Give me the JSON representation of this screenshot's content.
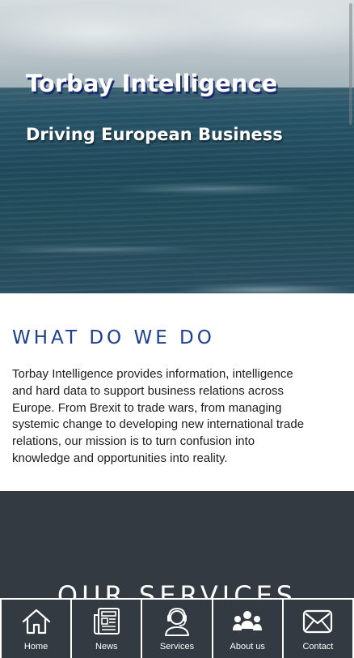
{
  "hero": {
    "title": "Torbay Intelligence",
    "subtitle": "Driving European Business"
  },
  "what_we_do": {
    "heading": "WHAT DO WE DO",
    "body": "Torbay Intelligence provides information, intelligence and hard data to support business relations across Europe. From Brexit to trade wars, from managing systemic change to developing new international trade relations, our mission is to turn confusion into knowledge and opportunities into reality."
  },
  "services": {
    "heading": "OUR SERVICES"
  },
  "bottom_nav": {
    "items": [
      {
        "label": "Home",
        "icon": "home-icon"
      },
      {
        "label": "News",
        "icon": "newspaper-icon"
      },
      {
        "label": "Services",
        "icon": "headset-agent-icon"
      },
      {
        "label": "About us",
        "icon": "team-icon"
      },
      {
        "label": "Contact",
        "icon": "envelope-icon"
      }
    ]
  },
  "colors": {
    "heading_blue": "#1d3f8f",
    "dark_panel": "#343a41",
    "title_shadow": "#1b2a6e"
  }
}
